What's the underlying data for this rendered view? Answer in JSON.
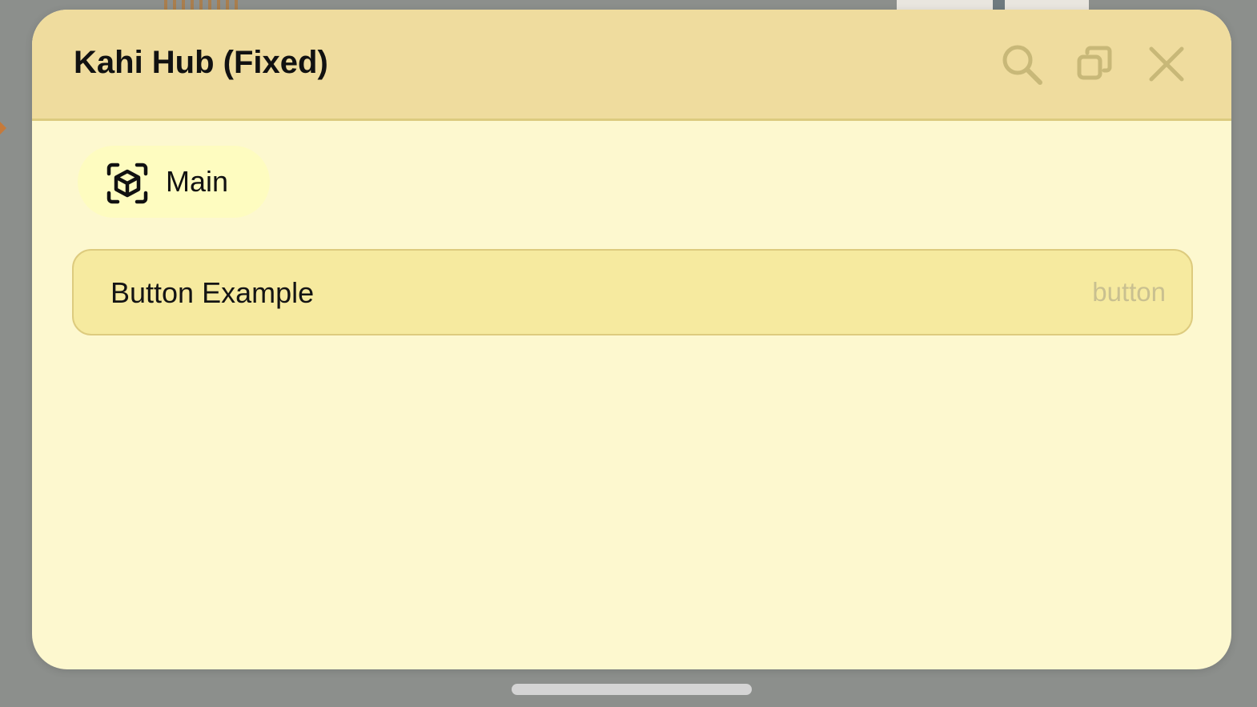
{
  "window": {
    "title": "Kahi Hub (Fixed)"
  },
  "titlebar_buttons": [
    {
      "icon": "search-icon"
    },
    {
      "icon": "restore-icon"
    },
    {
      "icon": "close-icon"
    }
  ],
  "tabs": [
    {
      "label": "Main",
      "icon": "cube-scan-icon",
      "selected": true
    }
  ],
  "elements": [
    {
      "title": "Button Example",
      "type": "button"
    }
  ],
  "colors": {
    "titlebar": "#efdc9e",
    "window_bg": "#fdf8cf",
    "tab_bg": "#fefcc0",
    "element_bg": "#f6ea9f",
    "element_border": "#ddcb7e",
    "icon_muted": "#c8b878",
    "type_hint": "#c9c090"
  }
}
